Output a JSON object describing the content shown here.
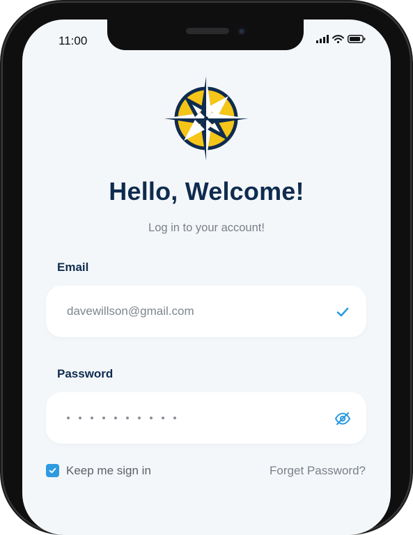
{
  "status_bar": {
    "time": "11:00"
  },
  "header": {
    "title": "Hello, Welcome!",
    "subtitle": "Log in to your account!"
  },
  "form": {
    "email": {
      "label": "Email",
      "value": "davewillson@gmail.com",
      "status_icon": "checkmark-icon"
    },
    "password": {
      "label": "Password",
      "masked_length": 10,
      "toggle_icon": "eye-slash-icon"
    },
    "remember": {
      "label": "Keep me sign in",
      "checked": true
    },
    "forgot_label": "Forget Password?"
  },
  "colors": {
    "navy": "#0f2c4f",
    "gold": "#f5c518",
    "accent_blue": "#2e9be0",
    "background": "#f4f7fa"
  }
}
